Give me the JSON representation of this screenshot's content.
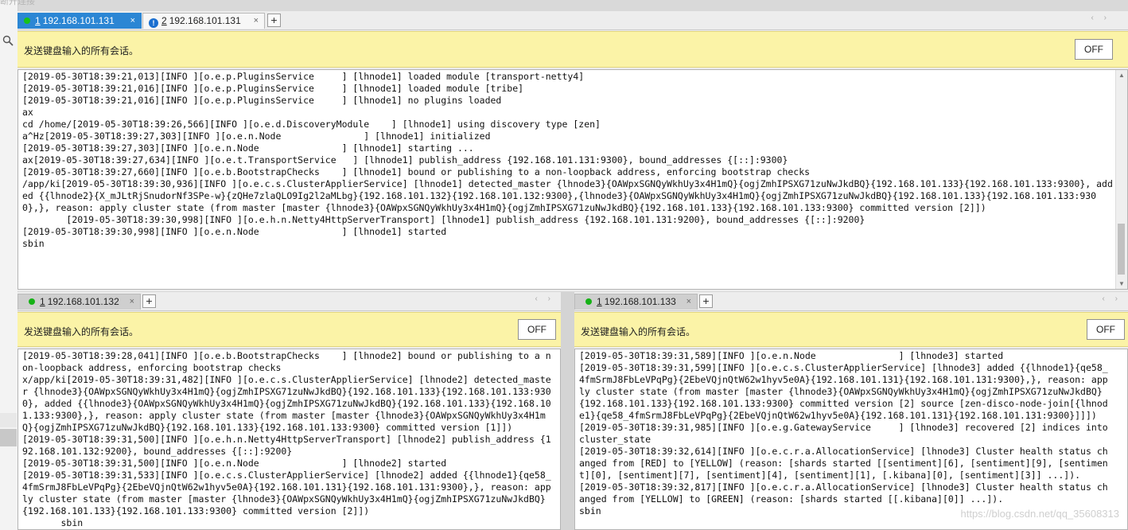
{
  "window": {
    "top_ghost_text": "断开连接"
  },
  "broadcast": {
    "label": "发送键盘输入的所有会话。",
    "toggle": "OFF"
  },
  "top_pane": {
    "tabs": [
      {
        "number": "1",
        "host": "192.168.101.131",
        "state": "active",
        "status": "connected"
      },
      {
        "number": "2",
        "host": "192.168.101.131",
        "state": "inactive",
        "status": "warning"
      }
    ],
    "close_glyph": "×",
    "add_glyph": "+",
    "nav_arrows": "‹ ›",
    "terminal_text": "[2019-05-30T18:39:21,013][INFO ][o.e.p.PluginsService     ] [lhnode1] loaded module [transport-netty4]\n[2019-05-30T18:39:21,016][INFO ][o.e.p.PluginsService     ] [lhnode1] loaded module [tribe]\n[2019-05-30T18:39:21,016][INFO ][o.e.p.PluginsService     ] [lhnode1] no plugins loaded\nax\ncd /home/[2019-05-30T18:39:26,566][INFO ][o.e.d.DiscoveryModule    ] [lhnode1] using discovery type [zen]\na^Hz[2019-05-30T18:39:27,303][INFO ][o.e.n.Node               ] [lhnode1] initialized\n[2019-05-30T18:39:27,303][INFO ][o.e.n.Node               ] [lhnode1] starting ...\nax[2019-05-30T18:39:27,634][INFO ][o.e.t.TransportService   ] [lhnode1] publish_address {192.168.101.131:9300}, bound_addresses {[::]:9300}\n[2019-05-30T18:39:27,660][INFO ][o.e.b.BootstrapChecks    ] [lhnode1] bound or publishing to a non-loopback address, enforcing bootstrap checks\n/app/ki[2019-05-30T18:39:30,936][INFO ][o.e.c.s.ClusterApplierService] [lhnode1] detected_master {lhnode3}{OAWpxSGNQyWkhUy3x4H1mQ}{ogjZmhIPSXG71zuNwJkdBQ}{192.168.101.133}{192.168.101.133:9300}, added {{lhnode2}{X_mJLtRjSnudorNf3SPe-w}{zQHe7zlaQLO9Ig2l2aMLbg}{192.168.101.132}{192.168.101.132:9300},{lhnode3}{OAWpxSGNQyWkhUy3x4H1mQ}{ogjZmhIPSXG71zuNwJkdBQ}{192.168.101.133}{192.168.101.133:9300},}, reason: apply cluster state (from master [master {lhnode3}{OAWpxSGNQyWkhUy3x4H1mQ}{ogjZmhIPSXG71zuNwJkdBQ}{192.168.101.133}{192.168.101.133:9300} committed version [2]])\n        [2019-05-30T18:39:30,998][INFO ][o.e.h.n.Netty4HttpServerTransport] [lhnode1] publish_address {192.168.101.131:9200}, bound_addresses {[::]:9200}\n[2019-05-30T18:39:30,998][INFO ][o.e.n.Node               ] [lhnode1] started\nsbin"
  },
  "bottom_left_pane": {
    "tab": {
      "number": "1",
      "host": "192.168.101.132",
      "status": "connected"
    },
    "terminal_text": "[2019-05-30T18:39:28,041][INFO ][o.e.b.BootstrapChecks    ] [lhnode2] bound or publishing to a non-loopback address, enforcing bootstrap checks\nx/app/ki[2019-05-30T18:39:31,482][INFO ][o.e.c.s.ClusterApplierService] [lhnode2] detected_master {lhnode3}{OAWpxSGNQyWkhUy3x4H1mQ}{ogjZmhIPSXG71zuNwJkdBQ}{192.168.101.133}{192.168.101.133:9300}, added {{lhnode3}{OAWpxSGNQyWkhUy3x4H1mQ}{ogjZmhIPSXG71zuNwJkdBQ}{192.168.101.133}{192.168.101.133:9300},}, reason: apply cluster state (from master [master {lhnode3}{OAWpxSGNQyWkhUy3x4H1mQ}{ogjZmhIPSXG71zuNwJkdBQ}{192.168.101.133}{192.168.101.133:9300} committed version [1]])\n[2019-05-30T18:39:31,500][INFO ][o.e.h.n.Netty4HttpServerTransport] [lhnode2] publish_address {192.168.101.132:9200}, bound_addresses {[::]:9200}\n[2019-05-30T18:39:31,500][INFO ][o.e.n.Node               ] [lhnode2] started\n[2019-05-30T18:39:31,533][INFO ][o.e.c.s.ClusterApplierService] [lhnode2] added {{lhnode1}{qe58_4fmSrmJ8FbLeVPqPg}{2EbeVQjnQtW62w1hyv5e0A}{192.168.101.131}{192.168.101.131:9300},}, reason: apply cluster state (from master [master {lhnode3}{OAWpxSGNQyWkhUy3x4H1mQ}{ogjZmhIPSXG71zuNwJkdBQ}{192.168.101.133}{192.168.101.133:9300} committed version [2]])\n       sbin"
  },
  "bottom_right_pane": {
    "tab": {
      "number": "1",
      "host": "192.168.101.133",
      "status": "connected"
    },
    "terminal_text": "[2019-05-30T18:39:31,589][INFO ][o.e.n.Node               ] [lhnode3] started\n[2019-05-30T18:39:31,599][INFO ][o.e.c.s.ClusterApplierService] [lhnode3] added {{lhnode1}{qe58_4fmSrmJ8FbLeVPqPg}{2EbeVQjnQtW62w1hyv5e0A}{192.168.101.131}{192.168.101.131:9300},}, reason: apply cluster state (from master [master {lhnode3}{OAWpxSGNQyWkhUy3x4H1mQ}{ogjZmhIPSXG71zuNwJkdBQ}{192.168.101.133}{192.168.101.133:9300} committed version [2] source [zen-disco-node-join[{lhnode1}{qe58_4fmSrmJ8FbLeVPqPg}{2EbeVQjnQtW62w1hyv5e0A}{192.168.101.131}{192.168.101.131:9300}]]])\n[2019-05-30T18:39:31,985][INFO ][o.e.g.GatewayService     ] [lhnode3] recovered [2] indices into cluster_state\n[2019-05-30T18:39:32,614][INFO ][o.e.c.r.a.AllocationService] [lhnode3] Cluster health status changed from [RED] to [YELLOW] (reason: [shards started [[sentiment][6], [sentiment][9], [sentiment][0], [sentiment][7], [sentiment][4], [sentiment][1], [.kibana][0], [sentiment][3]] ...]).\n[2019-05-30T18:39:32,817][INFO ][o.e.c.r.a.AllocationService] [lhnode3] Cluster health status changed from [YELLOW] to [GREEN] (reason: [shards started [[.kibana][0]] ...]).\nsbin",
    "watermark": "https://blog.csdn.net/qq_35608313"
  },
  "icons": {
    "connected": "green-dot",
    "warning": "exclamation-circle",
    "search": "magnifier"
  },
  "colors": {
    "active_tab": "#2b86d4",
    "broadcast_bar": "#fbf3a7",
    "connected_dot": "#16b216",
    "warning_badge": "#1b6fd0"
  }
}
